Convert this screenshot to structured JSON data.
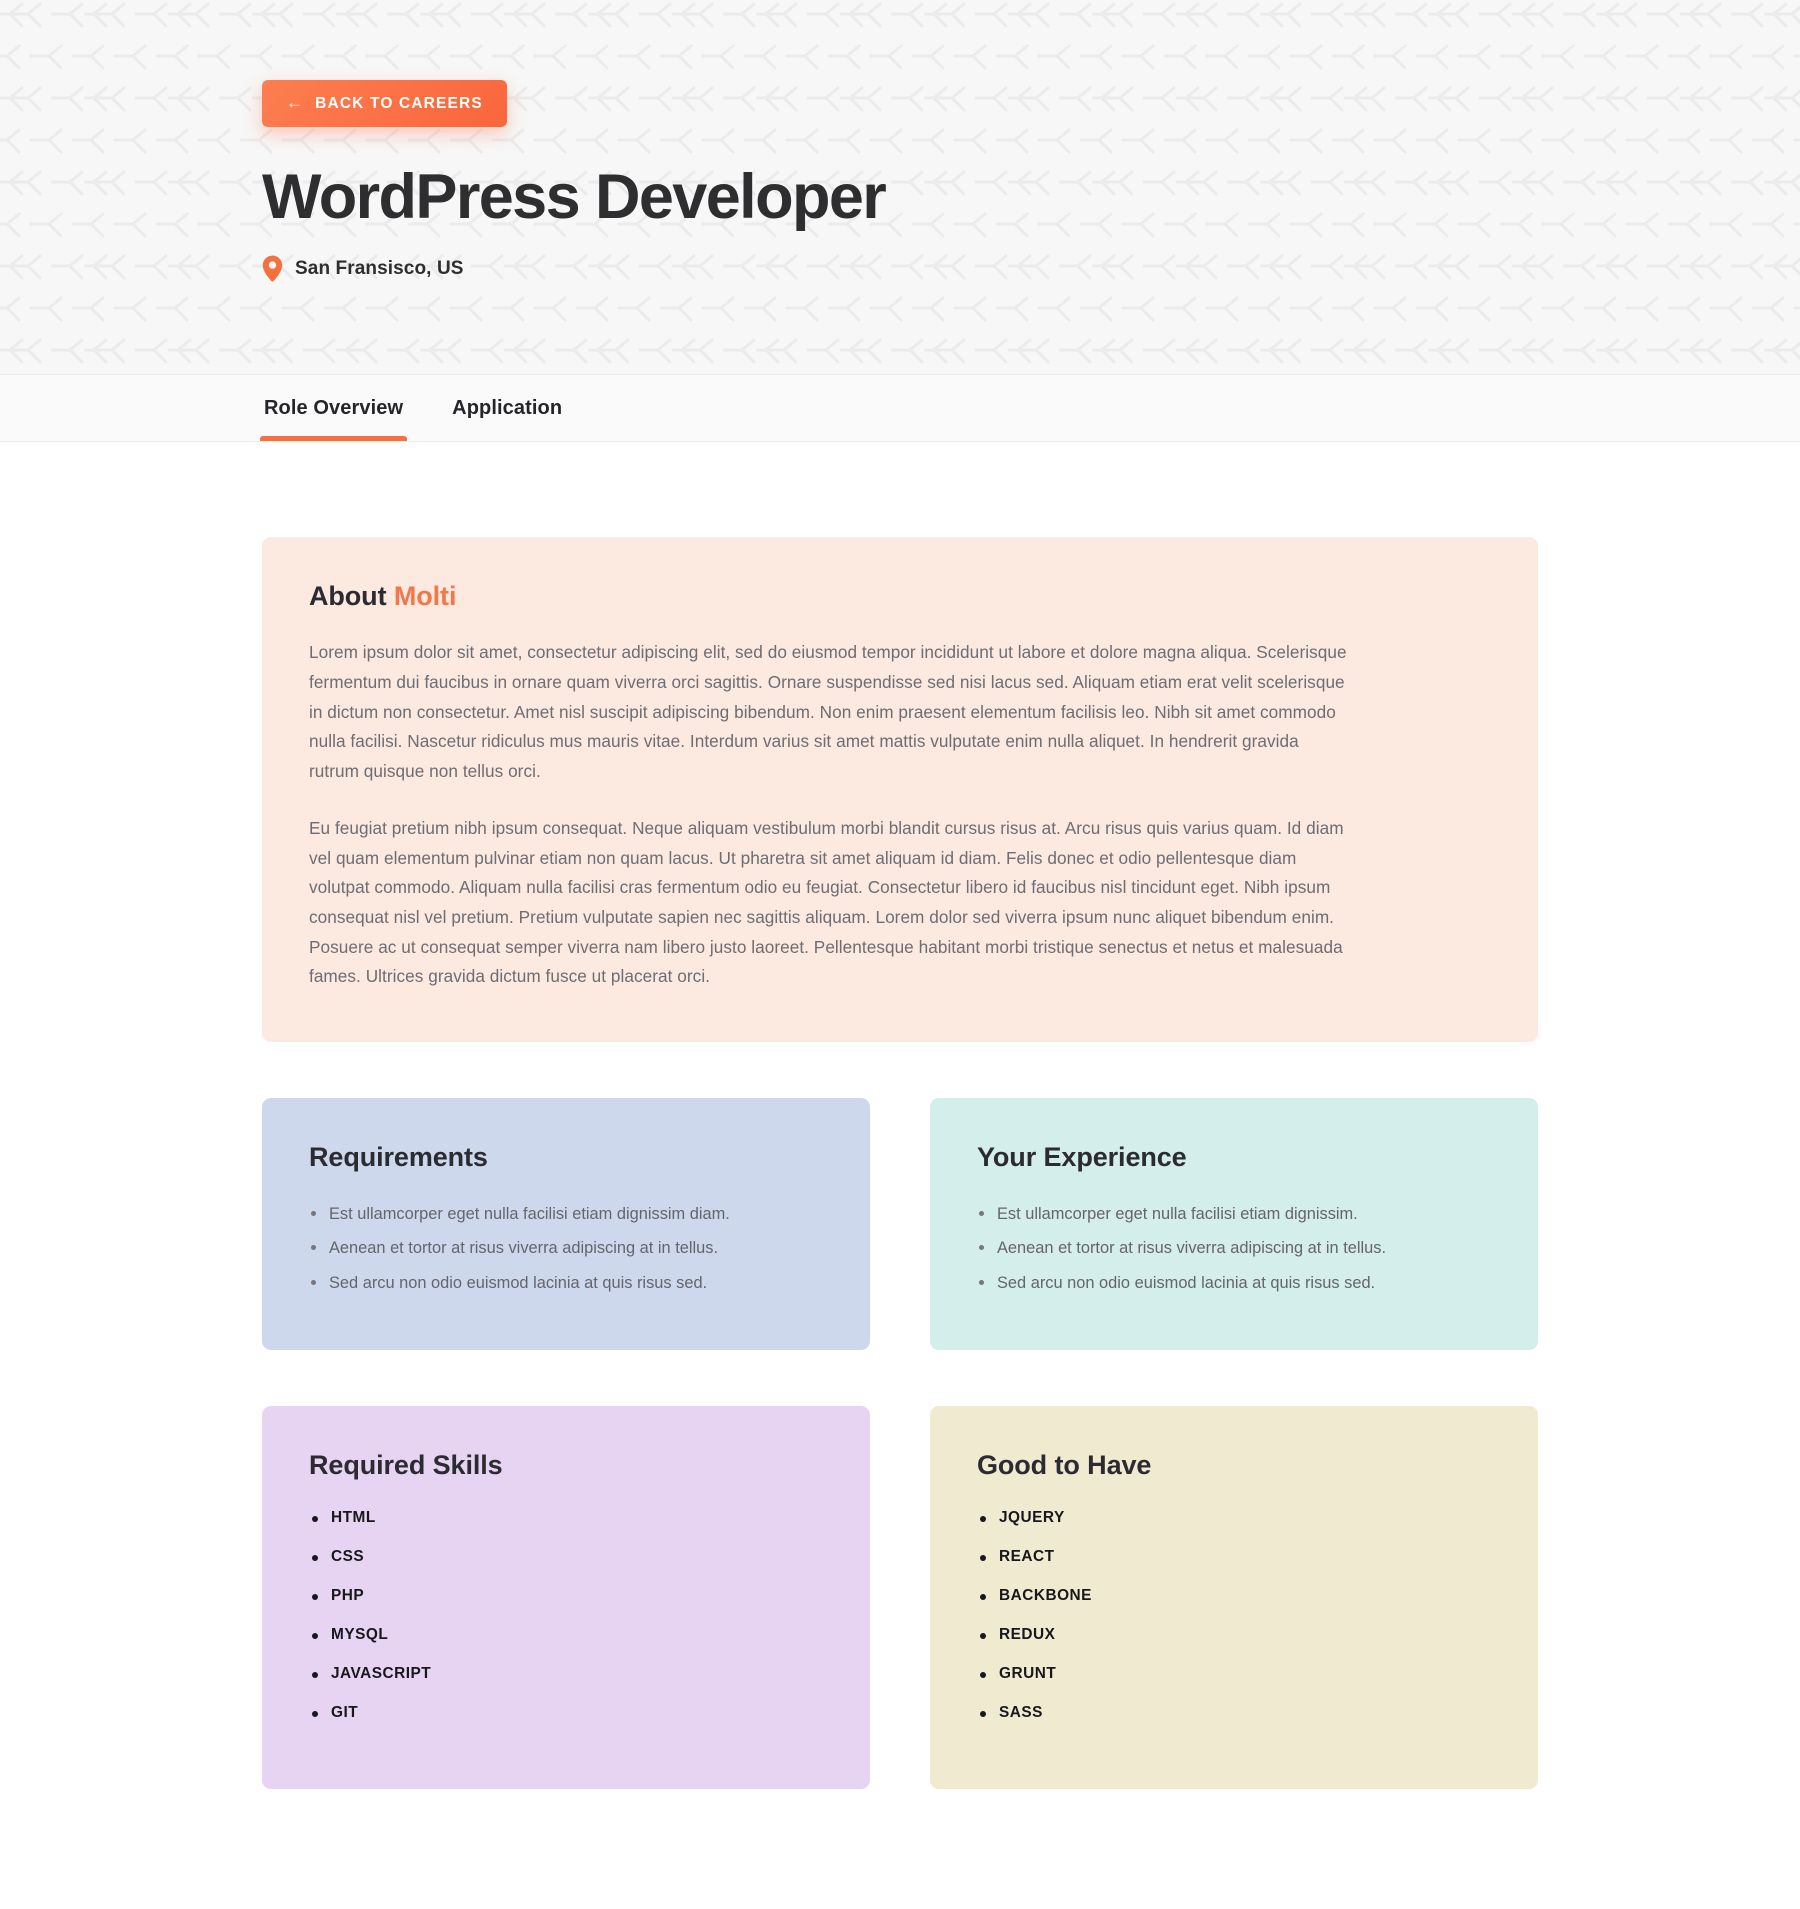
{
  "hero": {
    "back_button": {
      "label": "BACK TO CAREERS",
      "arrow": "←",
      "icon": "arrow-left-icon"
    },
    "title": "WordPress Developer",
    "location": "San Fransisco, US",
    "location_icon": "map-pin-icon",
    "accent_color": "#f4713f",
    "background_color": "#f7f7f7"
  },
  "tabs": [
    {
      "label": "Role Overview",
      "active": true
    },
    {
      "label": "Application",
      "active": false
    }
  ],
  "about": {
    "title_prefix": "About",
    "company": "Molti",
    "background_color": "#fce9e0",
    "paragraphs": [
      "Lorem ipsum dolor sit amet, consectetur adipiscing elit, sed do eiusmod tempor incididunt ut labore et dolore magna aliqua. Scelerisque fermentum dui faucibus in ornare quam viverra orci sagittis. Ornare suspendisse sed nisi lacus sed. Aliquam etiam erat velit scelerisque in dictum non consectetur. Amet nisl suscipit adipiscing bibendum. Non enim praesent elementum facilisis leo. Nibh sit amet commodo nulla facilisi. Nascetur ridiculus mus mauris vitae. Interdum varius sit amet mattis vulputate enim nulla aliquet. In hendrerit gravida rutrum quisque non tellus orci.",
      "Eu feugiat pretium nibh ipsum consequat. Neque aliquam vestibulum morbi blandit cursus risus at. Arcu risus quis varius quam. Id diam vel quam elementum pulvinar etiam non quam lacus. Ut pharetra sit amet aliquam id diam. Felis donec et odio pellentesque diam volutpat commodo. Aliquam nulla facilisi cras fermentum odio eu feugiat. Consectetur libero id faucibus nisl tincidunt eget. Nibh ipsum consequat nisl vel pretium. Pretium vulputate sapien nec sagittis aliquam. Lorem dolor sed viverra ipsum nunc aliquet bibendum enim. Posuere ac ut consequat semper viverra nam libero justo laoreet. Pellentesque habitant morbi tristique senectus et netus et malesuada fames. Ultrices gravida dictum fusce ut placerat orci."
    ]
  },
  "requirements": {
    "title": "Requirements",
    "background_color": "#cdd8ec",
    "items": [
      "Est ullamcorper eget nulla facilisi etiam dignissim diam.",
      "Aenean et tortor at risus viverra adipiscing at in tellus.",
      "Sed arcu non odio euismod lacinia at quis risus sed."
    ]
  },
  "experience": {
    "title": "Your Experience",
    "background_color": "#d3eeeb",
    "items": [
      "Est ullamcorper eget nulla facilisi etiam dignissim.",
      "Aenean et tortor at risus viverra adipiscing at in tellus.",
      "Sed arcu non odio euismod lacinia at quis risus sed."
    ]
  },
  "required_skills": {
    "title": "Required Skills",
    "background_color": "#e6d4f2",
    "items": [
      "HTML",
      "CSS",
      "PHP",
      "MYSQL",
      "JAVASCRIPT",
      "GIT"
    ]
  },
  "good_to_have": {
    "title": "Good to Have",
    "background_color": "#f0ead0",
    "items": [
      "JQUERY",
      "REACT",
      "BACKBONE",
      "REDUX",
      "GRUNT",
      "SASS"
    ]
  }
}
